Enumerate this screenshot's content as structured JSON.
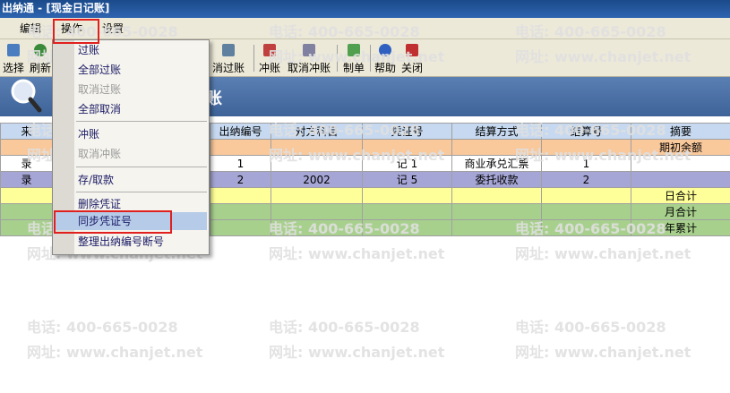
{
  "window": {
    "title": "出纳通 - [现金日记账]"
  },
  "menu": {
    "items": [
      "编辑",
      "操作",
      "设置"
    ]
  },
  "toolbar": {
    "buttons": [
      {
        "label": "选择",
        "icon": "select-icon",
        "color": "#4a7cc0"
      },
      {
        "label": "刷新",
        "icon": "refresh-icon",
        "color": "#3a8a3a"
      },
      {
        "label": "消过账",
        "icon": "unpost-icon",
        "color": "#6080a0"
      },
      {
        "label": "冲账",
        "icon": "reverse-icon",
        "color": "#c04040"
      },
      {
        "label": "取消冲账",
        "icon": "cancel-reverse-icon",
        "color": "#8080a0"
      },
      {
        "label": "制单",
        "icon": "make-voucher-icon",
        "color": "#50a050"
      },
      {
        "label": "帮助",
        "icon": "help-icon",
        "color": "#3060c0"
      },
      {
        "label": "关闭",
        "icon": "close-icon",
        "color": "#c03030"
      }
    ]
  },
  "banner": {
    "title": "账"
  },
  "table": {
    "headers": [
      "来",
      "",
      "出纳编号",
      "对方科目",
      "凭证号",
      "结算方式",
      "结算号",
      "摘要"
    ],
    "rows": [
      {
        "style": "orange",
        "cells": [
          "",
          "",
          "",
          "",
          "",
          "",
          "",
          "期初余额"
        ]
      },
      {
        "style": "white",
        "cells": [
          "录",
          "",
          "1",
          "",
          "记 1",
          "商业承兑汇票",
          "1",
          ""
        ]
      },
      {
        "style": "purple",
        "cells": [
          "录",
          "",
          "2",
          "2002",
          "记 5",
          "委托收款",
          "2",
          ""
        ]
      },
      {
        "style": "yellow",
        "cells": [
          "",
          "",
          "",
          "",
          "",
          "",
          "",
          "日合计"
        ]
      },
      {
        "style": "green",
        "cells": [
          "",
          "",
          "",
          "",
          "",
          "",
          "",
          "月合计"
        ]
      },
      {
        "style": "green",
        "cells": [
          "",
          "",
          "",
          "",
          "",
          "",
          "",
          "年累计"
        ]
      }
    ]
  },
  "popup_menu": {
    "items": [
      {
        "label": "过账",
        "enabled": true
      },
      {
        "label": "全部过账",
        "enabled": true
      },
      {
        "label": "取消过账",
        "enabled": false
      },
      {
        "label": "全部取消",
        "enabled": true
      },
      {
        "label": "冲账",
        "enabled": true
      },
      {
        "label": "取消冲账",
        "enabled": false
      },
      {
        "label": "存/取款",
        "enabled": true
      },
      {
        "label": "删除凭证",
        "enabled": true
      },
      {
        "label": "同步凭证号",
        "enabled": true,
        "highlighted": true
      },
      {
        "label": "整理出纳编号断号",
        "enabled": true
      }
    ]
  },
  "watermark": {
    "phone": "电话: 400-665-0028",
    "site": "网址: www.chanjet.net"
  },
  "colors": {
    "highlight_red": "#e0201e",
    "header_blue": "#c6d9f0",
    "banner_blue": "#4a6fa5"
  }
}
